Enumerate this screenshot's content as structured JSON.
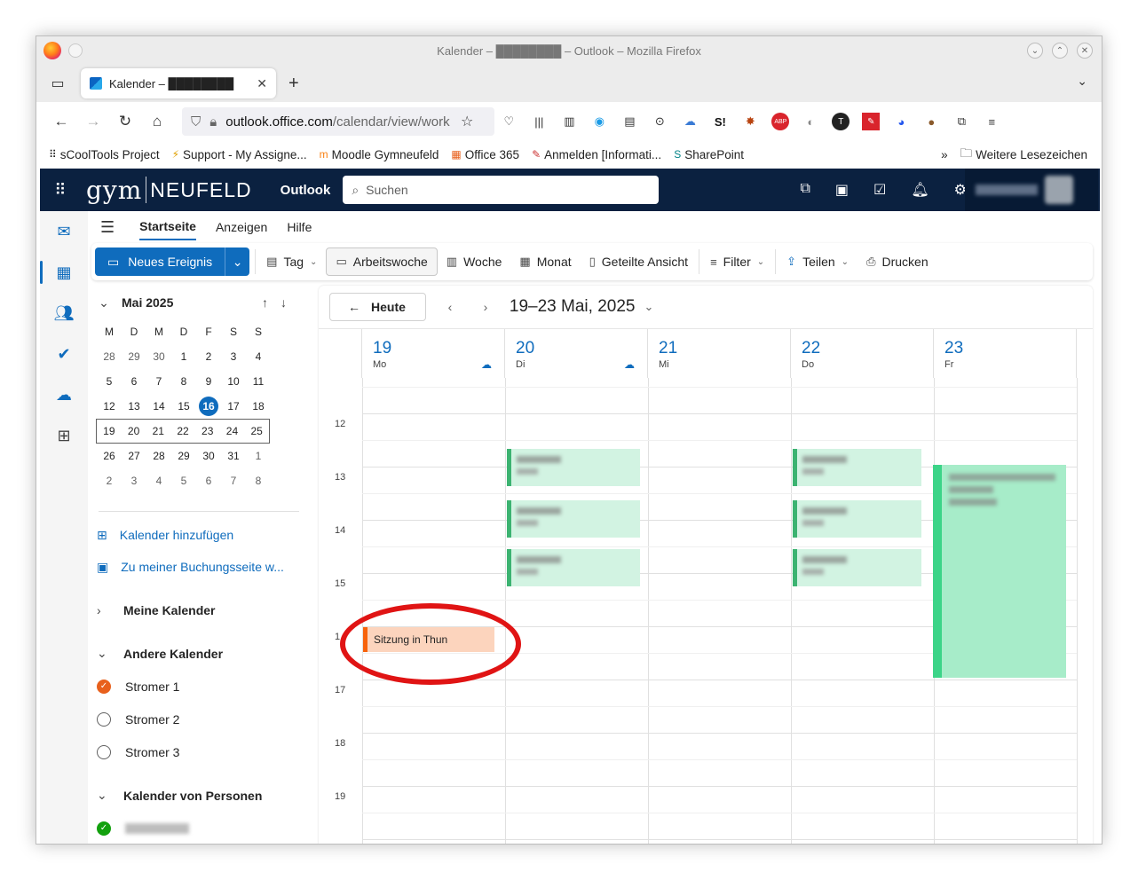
{
  "browser": {
    "window_title": "Kalender – ████████ – Outlook – Mozilla Firefox",
    "tab_title": "Kalender – ████████",
    "url_host": "outlook.office.com",
    "url_path": "/calendar/view/work",
    "bookmarks": [
      "sCoolTools Project",
      "Support - My Assigne...",
      "Moodle Gymneufeld",
      "Office 365",
      "Anmelden [Informati...",
      "SharePoint"
    ],
    "more_bookmarks": "Weitere Lesezeichen"
  },
  "header": {
    "brand_script": "gym",
    "brand_caps": "NEUFELD",
    "app_name": "Outlook",
    "search_placeholder": "Suchen"
  },
  "ribbon": {
    "tabs": [
      "Startseite",
      "Anzeigen",
      "Hilfe"
    ],
    "new_event": "Neues Ereignis",
    "day": "Tag",
    "work_week": "Arbeitswoche",
    "week": "Woche",
    "month": "Monat",
    "split": "Geteilte Ansicht",
    "filter": "Filter",
    "share": "Teilen",
    "print": "Drucken"
  },
  "mini_calendar": {
    "month": "Mai 2025",
    "weekdays": [
      "M",
      "D",
      "M",
      "D",
      "F",
      "S",
      "S"
    ],
    "weeks": [
      [
        "28",
        "29",
        "30",
        "1",
        "2",
        "3",
        "4"
      ],
      [
        "5",
        "6",
        "7",
        "8",
        "9",
        "10",
        "11"
      ],
      [
        "12",
        "13",
        "14",
        "15",
        "16",
        "17",
        "18"
      ],
      [
        "19",
        "20",
        "21",
        "22",
        "23",
        "24",
        "25"
      ],
      [
        "26",
        "27",
        "28",
        "29",
        "30",
        "31",
        "1"
      ],
      [
        "2",
        "3",
        "4",
        "5",
        "6",
        "7",
        "8"
      ]
    ],
    "today": "16"
  },
  "pane": {
    "add_calendar": "Kalender hinzufügen",
    "booking": "Zu meiner Buchungsseite w...",
    "my_calendars": "Meine Kalender",
    "other_calendars": "Andere Kalender",
    "calendars": [
      "Stromer 1",
      "Stromer 2",
      "Stromer 3"
    ],
    "people_calendars": "Kalender von Personen"
  },
  "calendar": {
    "today_btn": "Heute",
    "range": "19–23 Mai, 2025",
    "days": [
      {
        "num": "19",
        "name": "Mo"
      },
      {
        "num": "20",
        "name": "Di"
      },
      {
        "num": "21",
        "name": "Mi"
      },
      {
        "num": "22",
        "name": "Do"
      },
      {
        "num": "23",
        "name": "Fr"
      }
    ],
    "hours": [
      "12",
      "13",
      "14",
      "15",
      "1",
      "17",
      "18",
      "19"
    ],
    "event_title": "Sitzung in Thun"
  },
  "colors": {
    "accent": "#0f6cbd",
    "header_bg": "#0b2140",
    "event_green": "#d2f3e2",
    "event_orange": "#fcd4bd",
    "highlight_ring": "#e01414"
  }
}
